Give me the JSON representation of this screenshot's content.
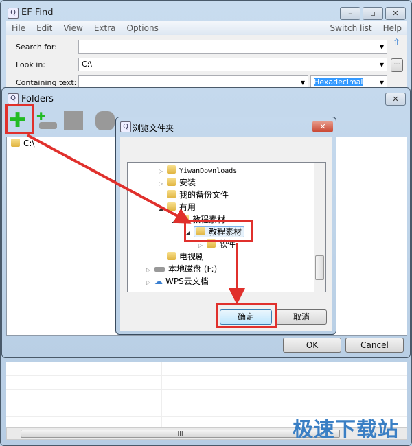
{
  "window": {
    "title": "EF Find",
    "min": "–",
    "max": "▫",
    "close": "✕"
  },
  "menu": {
    "items": [
      "File",
      "Edit",
      "View",
      "Extra",
      "Options"
    ],
    "switch_list": "Switch list",
    "help": "Help"
  },
  "form": {
    "search_label": "Search for:",
    "search_value": "",
    "lookin_label": "Look in:",
    "lookin_value": "C:\\",
    "browse_btn": "...",
    "containing_label": "Containing text:",
    "containing_value": "",
    "mode_value": "Hexadecimal"
  },
  "folders": {
    "title": "Folders",
    "close": "✕",
    "tree_items": [
      "C:\\"
    ],
    "ok": "OK",
    "cancel": "Cancel"
  },
  "browse": {
    "title": "浏览文件夹",
    "close": "✕",
    "items": [
      {
        "label": "YiwanDownloads",
        "expander": "▷"
      },
      {
        "label": "安装",
        "expander": "▷"
      },
      {
        "label": "我的备份文件",
        "expander": ""
      },
      {
        "label": "有用",
        "expander": "◢"
      },
      {
        "label": "教程素材",
        "expander": "◢"
      },
      {
        "label": "教程素材",
        "expander": "◢",
        "selected": true
      },
      {
        "label": "软件",
        "expander": "▷"
      },
      {
        "label": "电视剧",
        "expander": ""
      },
      {
        "label": "本地磁盘 (F:)",
        "expander": "▷",
        "icon": "drive"
      },
      {
        "label": "WPS云文档",
        "expander": "▷",
        "icon": "cloud"
      }
    ],
    "ok": "确定",
    "cancel": "取消"
  },
  "watermark": "极速下载站",
  "colors": {
    "annotation": "#e0302c",
    "selection": "#3399ff",
    "watermark": "#3a7fc4"
  }
}
